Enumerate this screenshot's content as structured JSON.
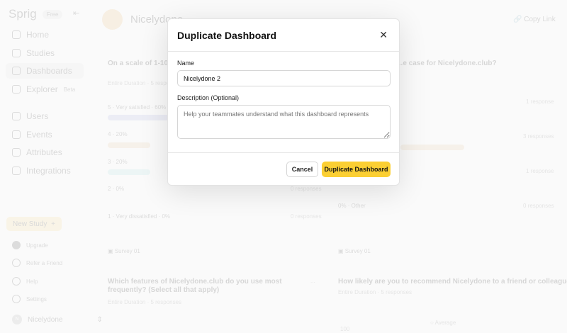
{
  "sidebar": {
    "logo": "Sprig",
    "plan_badge": "Free",
    "items": [
      {
        "label": "Home"
      },
      {
        "label": "Studies"
      },
      {
        "label": "Dashboards"
      },
      {
        "label": "Explorer",
        "badge": "Beta"
      },
      {
        "label": "Users"
      },
      {
        "label": "Events"
      },
      {
        "label": "Attributes"
      },
      {
        "label": "Integrations"
      }
    ],
    "new_study": "New Study",
    "bottom": [
      "Upgrade",
      "Refer a Friend",
      "Help",
      "Settings"
    ],
    "workspace": "Nicelydone",
    "workspace_initials": "N"
  },
  "header": {
    "title": "Nicelydone",
    "copy_link": "Copy Link"
  },
  "cards": {
    "left1": {
      "question": "On a scale of 1-10, how ... Nicelydone.club?",
      "meta": "Entire Duration · 5 responses",
      "rows": [
        {
          "label": "5 · Very satisfied · 60%",
          "pct": 60
        },
        {
          "label": "4 · 20%",
          "pct": 20
        },
        {
          "label": "3 · 20%",
          "pct": 20
        },
        {
          "label": "2 · 0%",
          "pct": 0,
          "count": "0 responses"
        },
        {
          "label": "1 · Very dissatisfied · 0%",
          "pct": 0,
          "count": "0 responses"
        }
      ]
    },
    "right1": {
      "question": "...e case for Nicelydone.club?",
      "counts": [
        "1 response",
        "3 responses",
        "1 response",
        "0 responses"
      ],
      "other": "0% · Other"
    },
    "left2": {
      "source": "Survey 01",
      "question": "Which features of Nicelydone.club do you use most frequently? (Select all that apply)",
      "meta": "Entire Duration · 5 responses",
      "more": "..."
    },
    "right2": {
      "source": "Survey 01",
      "question": "How likely are you to recommend Nicelydone to a friend or colleague?",
      "meta": "Entire Duration · 5 responses",
      "more": "...",
      "legend": "Average",
      "axis_top": "100"
    }
  },
  "modal": {
    "title": "Duplicate Dashboard",
    "name_label": "Name",
    "name_value": "Nicelydone 2",
    "desc_label": "Description (Optional)",
    "desc_placeholder": "Help your teammates understand what this dashboard represents",
    "cancel": "Cancel",
    "confirm": "Duplicate Dashboard",
    "accent": "#fbcf33"
  }
}
